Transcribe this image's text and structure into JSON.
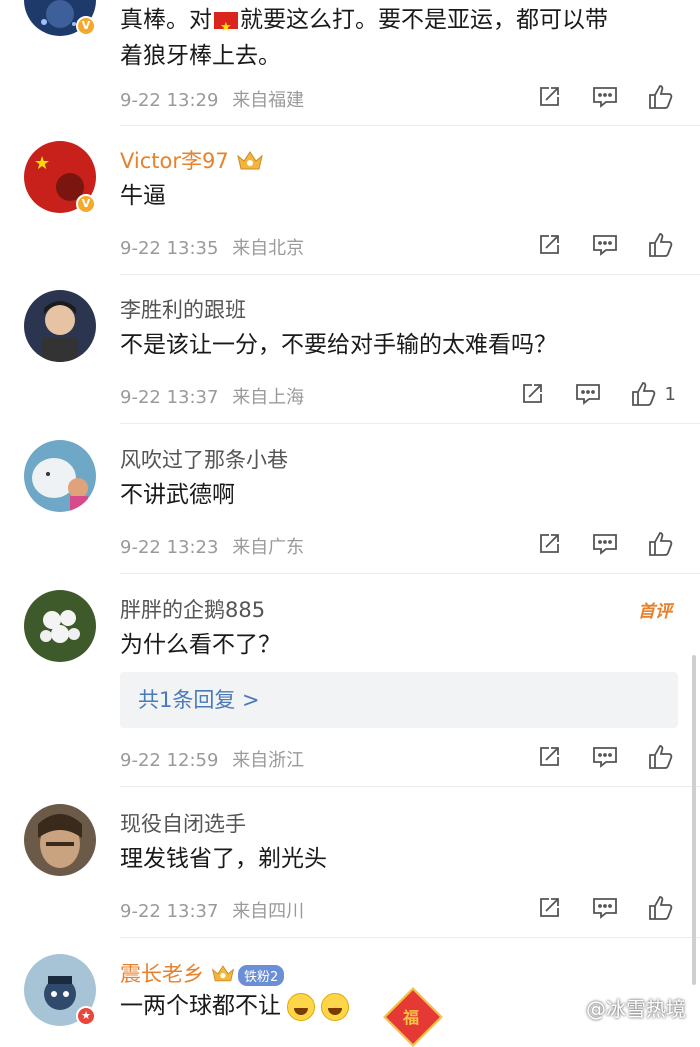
{
  "comments": [
    {
      "id": "c0",
      "text_line1": "真棒。对",
      "text_line1b": "就要这么打。要不是亚运，都可以带",
      "text_line2": "着狼牙棒上去。",
      "time": "9-22 13:29",
      "location": "来自福建"
    },
    {
      "id": "c1",
      "username": "Victor李97",
      "text": "牛逼",
      "time": "9-22 13:35",
      "location": "来自北京"
    },
    {
      "id": "c2",
      "username": "李胜利的跟班",
      "text": "不是该让一分，不要给对手输的太难看吗？",
      "time": "9-22 13:37",
      "location": "来自上海",
      "likes": "1"
    },
    {
      "id": "c3",
      "username": "风吹过了那条小巷",
      "text": "不讲武德啊",
      "time": "9-22 13:23",
      "location": "来自广东"
    },
    {
      "id": "c4",
      "username": "胖胖的企鹅885",
      "text": "为什么看不了？",
      "tag": "首评",
      "reply_summary": "共1条回复 >",
      "time": "9-22 12:59",
      "location": "来自浙江"
    },
    {
      "id": "c5",
      "username": "现役自闭选手",
      "text": "理发钱省了，剃光头",
      "time": "9-22 13:37",
      "location": "来自四川"
    },
    {
      "id": "c6",
      "username": "震长老乡",
      "fan_badge": "铁粉2",
      "text": "一两个球都不让",
      "fu": "福"
    }
  ],
  "watermark": "@冰雪热境",
  "colors": {
    "username_vip": "#e8812b",
    "reply_link": "#4a7ab8",
    "meta": "#9a9a9a"
  },
  "icons": [
    "repost-icon",
    "comment-icon",
    "like-icon"
  ]
}
